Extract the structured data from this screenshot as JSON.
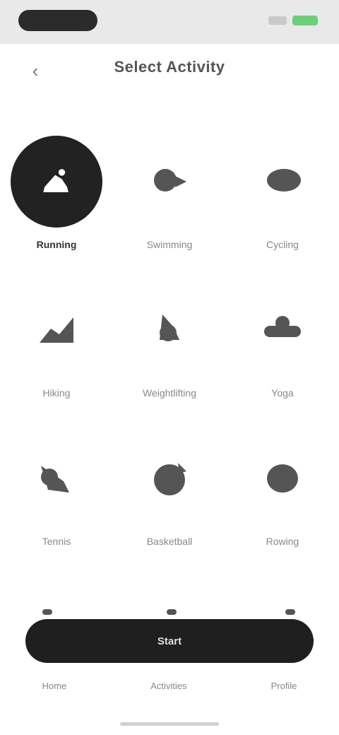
{
  "status_bar": {
    "colors": {
      "pill": "#2b2b2b",
      "battery": "#6ccf7a"
    }
  },
  "header": {
    "back_icon": "chevron-left-icon",
    "title": "Select Activity"
  },
  "activities": [
    {
      "label": "Running",
      "icon": "running-shoe-icon",
      "selected": true
    },
    {
      "label": "Swimming",
      "icon": "swim-icon",
      "selected": false
    },
    {
      "label": "Cycling",
      "icon": "bike-icon",
      "selected": false
    },
    {
      "label": "Hiking",
      "icon": "hiking-icon",
      "selected": false
    },
    {
      "label": "Weightlifting",
      "icon": "dumbbell-icon",
      "selected": false
    },
    {
      "label": "Yoga",
      "icon": "yoga-icon",
      "selected": false
    },
    {
      "label": "Tennis",
      "icon": "tennis-icon",
      "selected": false
    },
    {
      "label": "Basketball",
      "icon": "basketball-icon",
      "selected": false
    },
    {
      "label": "Rowing",
      "icon": "rowing-icon",
      "selected": false
    }
  ],
  "footer": {
    "primary_label": "Start",
    "tabs": [
      "Home",
      "Activities",
      "Profile"
    ]
  },
  "colors": {
    "accent": "#1f1f1f",
    "text_muted": "#888888",
    "background": "#ffffff"
  }
}
